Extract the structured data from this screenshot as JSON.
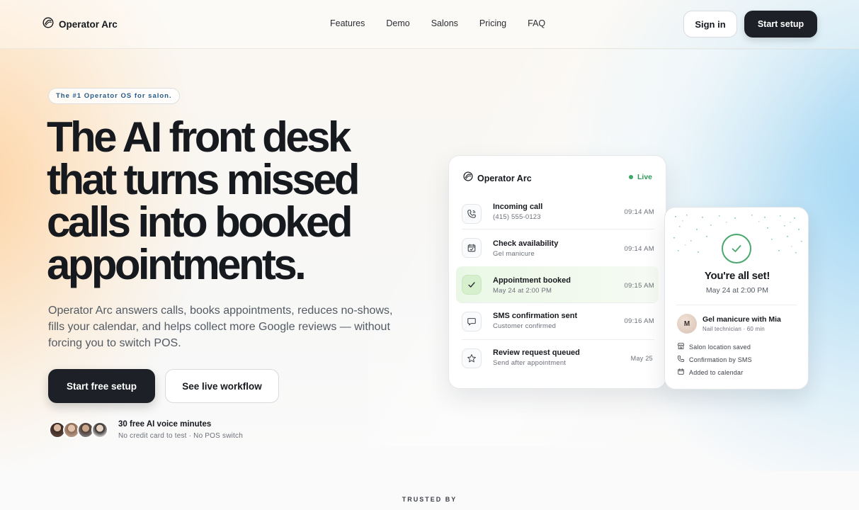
{
  "nav": {
    "brand": "Operator Arc",
    "links": [
      "Features",
      "Demo",
      "Salons",
      "Pricing",
      "FAQ"
    ],
    "sign_in": "Sign in",
    "start_setup": "Start setup"
  },
  "hero": {
    "badge": "The #1 Operator OS for salon.",
    "headline_lines": [
      "The AI front desk",
      "that turns missed",
      "calls into booked",
      "appointments."
    ],
    "subhead": "Operator Arc answers calls, books appointments, reduces no-shows, fills your calendar, and helps collect more Google reviews — without forcing you to switch POS.",
    "cta_primary": "Start free setup",
    "cta_secondary": "See live workflow",
    "proof_title": "30 free AI voice minutes",
    "proof_sub": "No credit card to test · No POS switch"
  },
  "activity_card": {
    "title": "Operator Arc",
    "status": "Live",
    "rows": [
      {
        "icon": "phone-icon",
        "title": "Incoming call",
        "sub": "(415) 555-0123",
        "time": "09:14 AM"
      },
      {
        "icon": "calendar-check-icon",
        "title": "Check availability",
        "sub": "Gel manicure",
        "time": "09:14 AM"
      },
      {
        "icon": "checkmark-icon",
        "title": "Appointment booked",
        "sub": "May 24 at 2:00 PM",
        "time": "09:15 AM"
      },
      {
        "icon": "chat-bubble-icon",
        "title": "SMS confirmation sent",
        "sub": "Customer confirmed",
        "time": "09:16 AM"
      },
      {
        "icon": "star-icon",
        "title": "Review request queued",
        "sub": "Send after appointment",
        "time": "May 25"
      }
    ]
  },
  "confirm_card": {
    "title": "You're all set!",
    "date": "May 24 at 2:00 PM",
    "avatar_initial": "M",
    "service": "Gel manicure with Mia",
    "service_sub": "Nail technician · 60 min",
    "details": [
      {
        "icon": "storefront-icon",
        "text": "Salon location saved"
      },
      {
        "icon": "phone-icon",
        "text": "Confirmation by SMS"
      },
      {
        "icon": "calendar-icon",
        "text": "Added to calendar"
      }
    ]
  },
  "trusted_by": "TRUSTED BY",
  "colors": {
    "primary_button": "#1d2127",
    "live_green": "#3aa764",
    "badge_text": "#245a88",
    "highlight_row": "#eaf7e6"
  }
}
